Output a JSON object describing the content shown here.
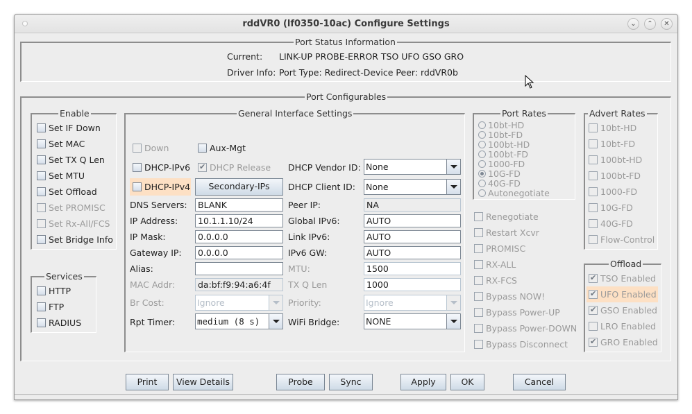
{
  "window": {
    "title": "rddVR0  (lf0350-10ac) Configure Settings",
    "controls": {
      "minimize": "⌄",
      "maximize": "⌃",
      "close": "✕"
    }
  },
  "status": {
    "legend": "Port Status Information",
    "current_label": "Current:",
    "current_value": "LINK-UP PROBE-ERROR TSO UFO GSO GRO",
    "driver_label": "Driver Info:",
    "driver_value": "Port Type: Redirect-Device   Peer: rddVR0b"
  },
  "configurables": {
    "legend": "Port Configurables"
  },
  "enable": {
    "legend": "Enable",
    "items": [
      {
        "label": "Set IF Down",
        "checked": false,
        "disabled": false
      },
      {
        "label": "Set MAC",
        "checked": false,
        "disabled": false
      },
      {
        "label": "Set TX Q Len",
        "checked": false,
        "disabled": false
      },
      {
        "label": "Set MTU",
        "checked": false,
        "disabled": false
      },
      {
        "label": "Set Offload",
        "checked": false,
        "disabled": false
      },
      {
        "label": "Set PROMISC",
        "checked": false,
        "disabled": true
      },
      {
        "label": "Set Rx-All/FCS",
        "checked": false,
        "disabled": true
      },
      {
        "label": "Set Bridge Info",
        "checked": false,
        "disabled": false
      }
    ]
  },
  "services": {
    "legend": "Services",
    "items": [
      {
        "label": "HTTP",
        "checked": false
      },
      {
        "label": "FTP",
        "checked": false
      },
      {
        "label": "RADIUS",
        "checked": false
      }
    ]
  },
  "general": {
    "legend": "General Interface Settings",
    "down_label": "Down",
    "aux_mgt_label": "Aux-Mgt",
    "dhcp_ipv6_label": "DHCP-IPv6",
    "dhcp_release_label": "DHCP Release",
    "dhcp_ipv4_label": "DHCP-IPv4",
    "secondary_ips_label": "Secondary-IPs",
    "dns_label": "DNS Servers:",
    "dns_value": "BLANK",
    "ip_label": "IP Address:",
    "ip_value": "10.1.1.10/24",
    "mask_label": "IP Mask:",
    "mask_value": "0.0.0.0",
    "gw_label": "Gateway IP:",
    "gw_value": "0.0.0.0",
    "alias_label": "Alias:",
    "alias_value": "",
    "mac_label": "MAC Addr:",
    "mac_value": "da:bf:f9:94:a6:4f",
    "brcost_label": "Br Cost:",
    "brcost_value": "Ignore",
    "rpt_label": "Rpt Timer:",
    "rpt_value": "medium  (8 s)",
    "vendor_label": "DHCP Vendor ID:",
    "vendor_value": "None",
    "client_label": "DHCP Client ID:",
    "client_value": "None",
    "peer_label": "Peer IP:",
    "peer_value": "NA",
    "global6_label": "Global IPv6:",
    "global6_value": "AUTO",
    "link6_label": "Link IPv6:",
    "link6_value": "AUTO",
    "gw6_label": "IPv6 GW:",
    "gw6_value": "AUTO",
    "mtu_label": "MTU:",
    "mtu_value": "1500",
    "txq_label": "TX Q Len",
    "txq_value": "1000",
    "priority_label": "Priority:",
    "priority_value": "Ignore",
    "wifi_label": "WiFi Bridge:",
    "wifi_value": "NONE"
  },
  "port_rates": {
    "legend": "Port Rates",
    "items": [
      {
        "label": "10bt-HD",
        "selected": false
      },
      {
        "label": "10bt-FD",
        "selected": false
      },
      {
        "label": "100bt-HD",
        "selected": false
      },
      {
        "label": "100bt-FD",
        "selected": false
      },
      {
        "label": "1000-FD",
        "selected": false
      },
      {
        "label": "10G-FD",
        "selected": true
      },
      {
        "label": "40G-FD",
        "selected": false
      },
      {
        "label": "Autonegotiate",
        "selected": false
      }
    ]
  },
  "misc": {
    "items": [
      {
        "label": "Renegotiate"
      },
      {
        "label": "Restart Xcvr"
      },
      {
        "label": "PROMISC"
      },
      {
        "label": "RX-ALL"
      },
      {
        "label": "RX-FCS"
      },
      {
        "label": "Bypass NOW!"
      },
      {
        "label": "Bypass Power-UP"
      },
      {
        "label": "Bypass Power-DOWN"
      },
      {
        "label": "Bypass Disconnect"
      }
    ]
  },
  "advert_rates": {
    "legend": "Advert Rates",
    "items": [
      {
        "label": "10bt-HD"
      },
      {
        "label": "10bt-FD"
      },
      {
        "label": "100bt-HD"
      },
      {
        "label": "100bt-FD"
      },
      {
        "label": "1000-FD"
      },
      {
        "label": "10G-FD"
      },
      {
        "label": "40G-FD"
      },
      {
        "label": "Flow-Control"
      }
    ]
  },
  "offload": {
    "legend": "Offload",
    "items": [
      {
        "label": "TSO Enabled",
        "checked": true
      },
      {
        "label": "UFO Enabled",
        "checked": true
      },
      {
        "label": "GSO Enabled",
        "checked": true
      },
      {
        "label": "LRO Enabled",
        "checked": false
      },
      {
        "label": "GRO Enabled",
        "checked": true
      }
    ]
  },
  "buttons": {
    "print": "Print",
    "view_details": "View Details",
    "probe": "Probe",
    "sync": "Sync",
    "apply": "Apply",
    "ok": "OK",
    "cancel": "Cancel"
  },
  "colors": {
    "highlight": "#fde0c4",
    "window_bg": "#ededed"
  }
}
